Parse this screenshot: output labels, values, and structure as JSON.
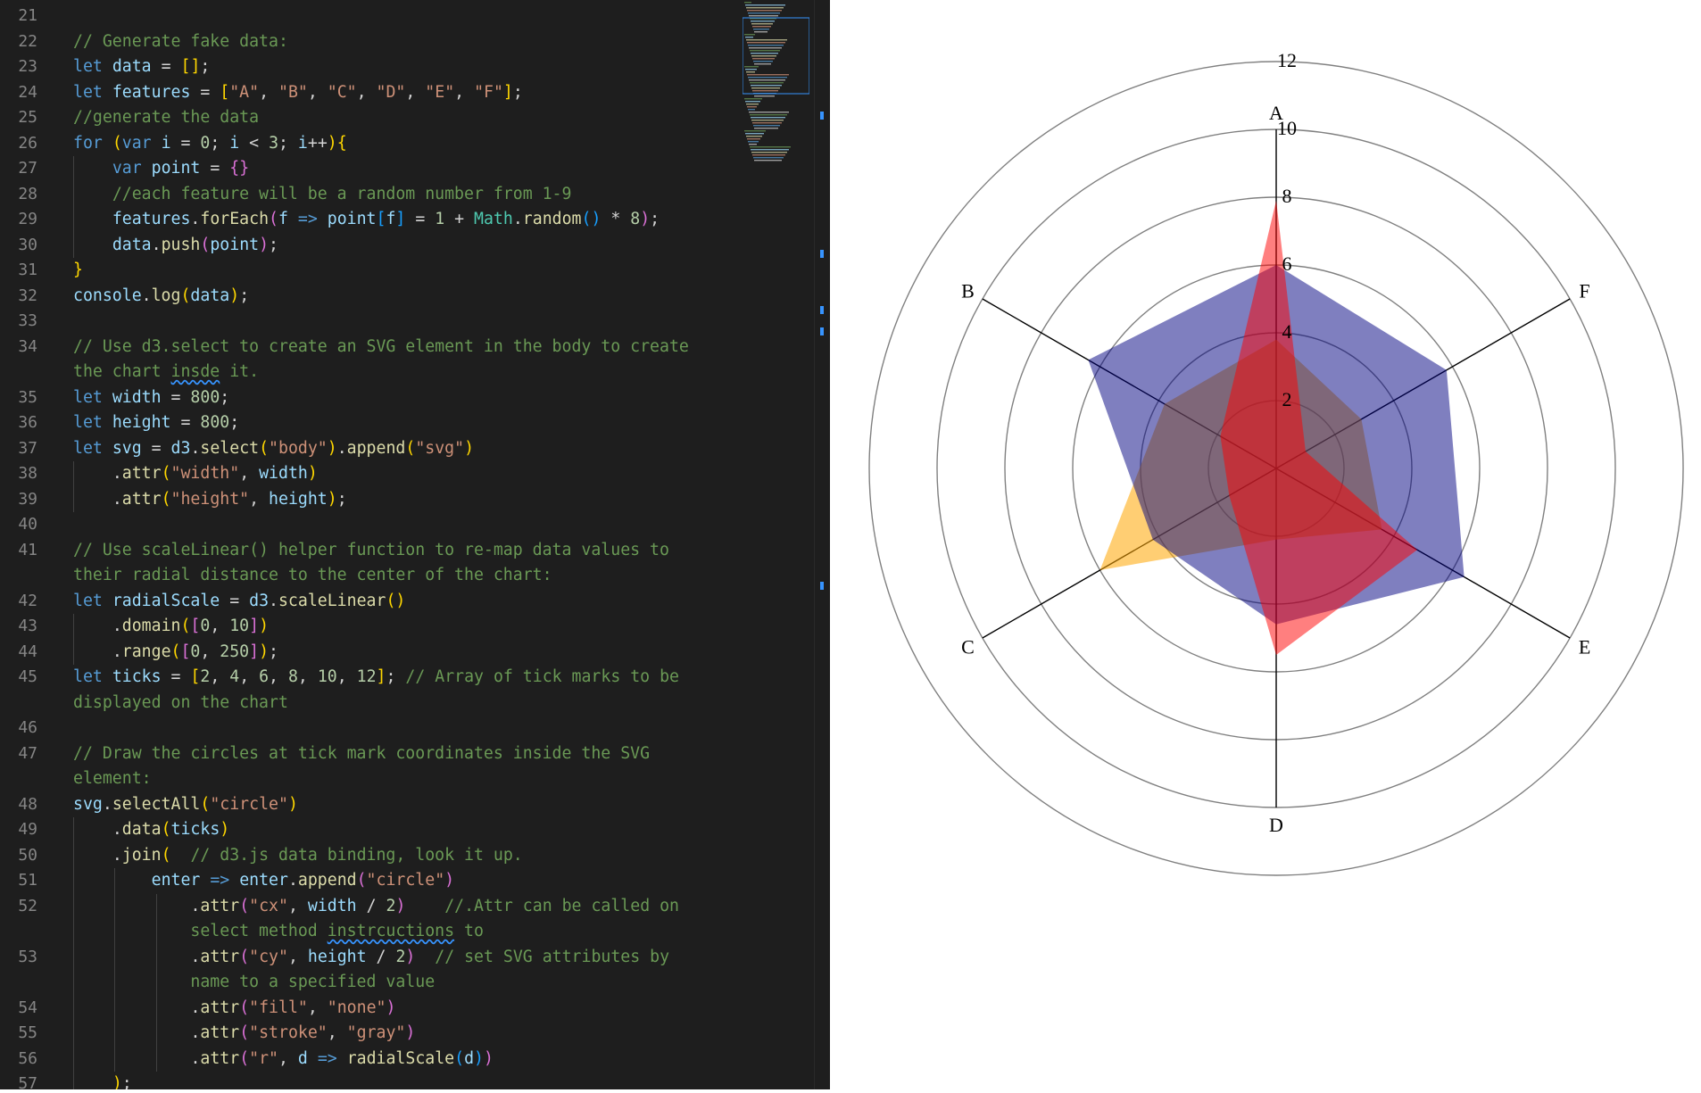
{
  "editor": {
    "lines": [
      {
        "n": "21",
        "code": ""
      },
      {
        "n": "22",
        "code": "// Generate fake data:"
      },
      {
        "n": "23",
        "code": "let data = [];"
      },
      {
        "n": "24",
        "code": "let features = [\"A\", \"B\", \"C\", \"D\", \"E\", \"F\"];"
      },
      {
        "n": "25",
        "code": "//generate the data"
      },
      {
        "n": "26",
        "code": "for (var i = 0; i < 3; i++){"
      },
      {
        "n": "27",
        "code": "    var point = {}"
      },
      {
        "n": "28",
        "code": "    //each feature will be a random number from 1-9"
      },
      {
        "n": "29",
        "code": "    features.forEach(f => point[f] = 1 + Math.random() * 8);"
      },
      {
        "n": "30",
        "code": "    data.push(point);"
      },
      {
        "n": "31",
        "code": "}"
      },
      {
        "n": "32",
        "code": "console.log(data);"
      },
      {
        "n": "33",
        "code": ""
      },
      {
        "n": "34",
        "code": "// Use d3.select to create an SVG element in the body to create"
      },
      {
        "n": "",
        "code": "the chart insde it."
      },
      {
        "n": "35",
        "code": "let width = 800;"
      },
      {
        "n": "36",
        "code": "let height = 800;"
      },
      {
        "n": "37",
        "code": "let svg = d3.select(\"body\").append(\"svg\")"
      },
      {
        "n": "38",
        "code": "    .attr(\"width\", width)"
      },
      {
        "n": "39",
        "code": "    .attr(\"height\", height);"
      },
      {
        "n": "40",
        "code": ""
      },
      {
        "n": "41",
        "code": "// Use scaleLinear() helper function to re-map data values to"
      },
      {
        "n": "",
        "code": "their radial distance to the center of the chart:"
      },
      {
        "n": "42",
        "code": "let radialScale = d3.scaleLinear()"
      },
      {
        "n": "43",
        "code": "    .domain([0, 10])"
      },
      {
        "n": "44",
        "code": "    .range([0, 250]);"
      },
      {
        "n": "45",
        "code": "let ticks = [2, 4, 6, 8, 10, 12]; // Array of tick marks to be"
      },
      {
        "n": "",
        "code": "displayed on the chart"
      },
      {
        "n": "46",
        "code": ""
      },
      {
        "n": "47",
        "code": "// Draw the circles at tick mark coordinates inside the SVG"
      },
      {
        "n": "",
        "code": "element:"
      },
      {
        "n": "48",
        "code": "svg.selectAll(\"circle\")"
      },
      {
        "n": "49",
        "code": "    .data(ticks)"
      },
      {
        "n": "50",
        "code": "    .join(  // d3.js data binding, look it up."
      },
      {
        "n": "51",
        "code": "        enter => enter.append(\"circle\")"
      },
      {
        "n": "52",
        "code": "            .attr(\"cx\", width / 2)    //.Attr can be called on"
      },
      {
        "n": "",
        "code": "            select method instrcuctions to"
      },
      {
        "n": "53",
        "code": "            .attr(\"cy\", height / 2)  // set SVG attributes by"
      },
      {
        "n": "",
        "code": "            name to a specified value"
      },
      {
        "n": "54",
        "code": "            .attr(\"fill\", \"none\")"
      },
      {
        "n": "55",
        "code": "            .attr(\"stroke\", \"gray\")"
      },
      {
        "n": "56",
        "code": "            .attr(\"r\", d => radialScale(d))"
      },
      {
        "n": "57",
        "code": "    );"
      }
    ]
  },
  "chart_data": {
    "type": "radar",
    "features": [
      "A",
      "B",
      "C",
      "D",
      "E",
      "F"
    ],
    "ticks": [
      2,
      4,
      6,
      8,
      10,
      12
    ],
    "tick_labels": [
      "2",
      "4",
      "6",
      "8",
      "10",
      "12"
    ],
    "domain": [
      0,
      10
    ],
    "series": [
      {
        "color": "#ffa500",
        "opacity": 0.55,
        "values": {
          "A": 3.8,
          "B": 3.8,
          "C": 6.0,
          "D": 2.1,
          "E": 3.6,
          "F": 2.9
        }
      },
      {
        "color": "#000080",
        "opacity": 0.5,
        "values": {
          "A": 6.0,
          "B": 6.4,
          "C": 4.2,
          "D": 4.6,
          "E": 6.4,
          "F": 5.8
        }
      },
      {
        "color": "#ff0000",
        "opacity": 0.5,
        "values": {
          "A": 7.9,
          "B": 1.9,
          "C": 1.6,
          "D": 5.5,
          "E": 4.8,
          "F": 1.0
        }
      }
    ]
  }
}
